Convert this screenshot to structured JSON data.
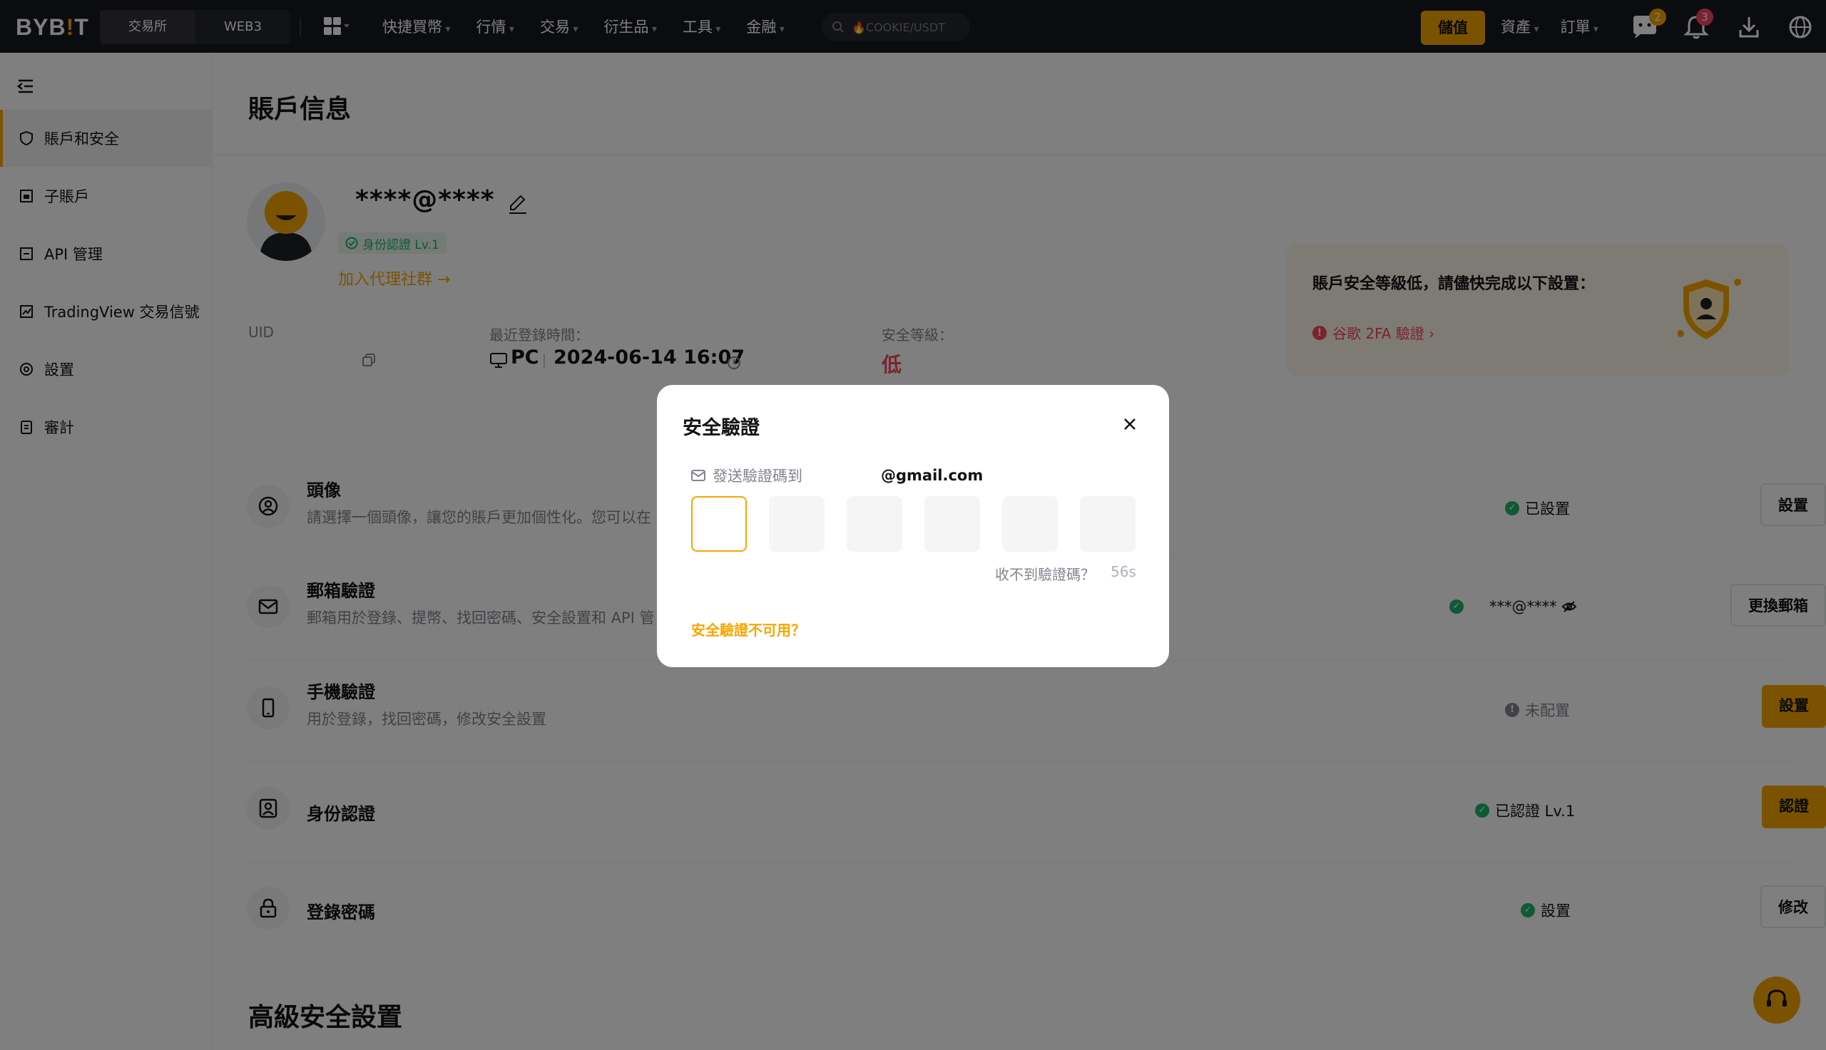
{
  "topnav": {
    "logo_main": "BYB",
    "logo_dot": "!",
    "logo_end": "T",
    "segments": [
      "交易所",
      "WEB3"
    ],
    "menu": [
      "快捷買幣",
      "行情",
      "交易",
      "衍生品",
      "工具",
      "金融"
    ],
    "search_placeholder": "🔥COOKIE/USDT",
    "deposit_label": "儲值",
    "right_menu": [
      "資產",
      "訂單"
    ],
    "chat_badge": "2",
    "bell_badge": "3",
    "accent_color": "#f7a600"
  },
  "sidebar": {
    "items": [
      {
        "label": "賬戶和安全",
        "icon": "shield-icon"
      },
      {
        "label": "子賬戶",
        "icon": "sub-account-icon"
      },
      {
        "label": "API 管理",
        "icon": "api-icon"
      },
      {
        "label": "TradingView 交易信號",
        "icon": "tradingview-icon"
      },
      {
        "label": "設置",
        "icon": "settings-icon"
      },
      {
        "label": "審計",
        "icon": "audit-icon"
      }
    ]
  },
  "account": {
    "title": "賬戶信息",
    "email_masked": "****@****",
    "kyc_badge": "身份認證 Lv.1",
    "join_link": "加入代理社群 →",
    "uid_label": "UID",
    "last_login_label": "最近登錄時間：",
    "last_login_device": "PC",
    "last_login_time": "2024-06-14 16:07",
    "security_level_label": "安全等級：",
    "security_level_value": "低"
  },
  "security_notice": {
    "title": "賬戶安全等級低，請儘快完成以下設置：",
    "item": "谷歌 2FA 驗證 ›"
  },
  "rows": [
    {
      "title": "頭像",
      "desc": "請選擇一個頭像，讓您的賬戶更加個性化。您可以在",
      "status": "已設置",
      "button": "設置"
    },
    {
      "title": "郵箱驗證",
      "desc": "郵箱用於登錄、提幣、找回密碼、安全設置和 API 管",
      "status": "***@****",
      "button": "更換郵箱"
    },
    {
      "title": "手機驗證",
      "desc": "用於登錄，找回密碼，修改安全設置",
      "status": "未配置",
      "button": "設置"
    },
    {
      "title": "身份認證",
      "desc": "",
      "status": "已認證 Lv.1",
      "button": "認證"
    },
    {
      "title": "登錄密碼",
      "desc": "",
      "status": "設置",
      "button": "修改"
    }
  ],
  "advanced_title": "高級安全設置",
  "modal": {
    "title": "安全驗證",
    "send_label": "發送驗證碼到",
    "email": "@gmail.com",
    "resend_label": "收不到驗證碼？",
    "countdown": "56s",
    "unavailable_link": "安全驗證不可用？"
  }
}
